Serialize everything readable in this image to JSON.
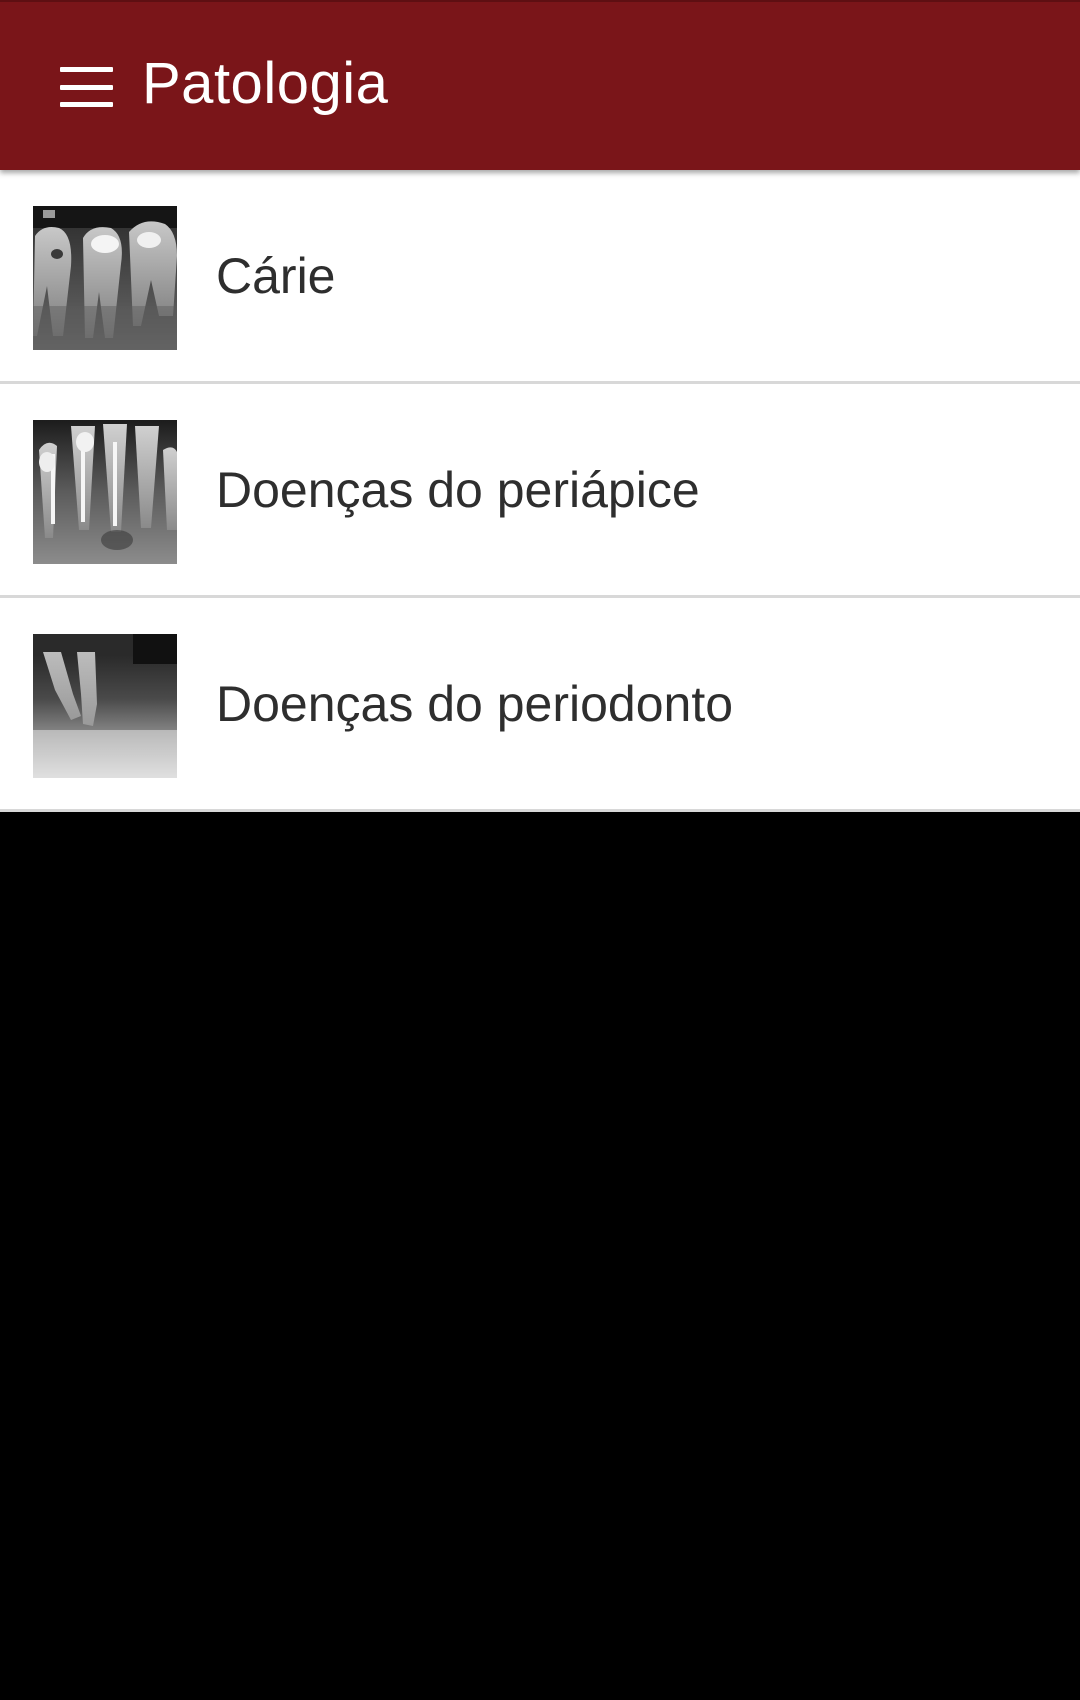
{
  "toolbar": {
    "title": "Patologia",
    "background_color": "#7a1519",
    "menu_icon": "hamburger-menu-icon"
  },
  "list": {
    "items": [
      {
        "label": "Cárie",
        "thumbnail": "xray-caries-thumbnail"
      },
      {
        "label": "Doenças do periápice",
        "thumbnail": "xray-periapical-thumbnail"
      },
      {
        "label": "Doenças do periodonto",
        "thumbnail": "xray-periodontal-thumbnail"
      }
    ]
  },
  "colors": {
    "list_background": "#ffffff",
    "divider": "#d8d8d8",
    "empty_area": "#000000",
    "label_text": "#2e2e2e"
  }
}
